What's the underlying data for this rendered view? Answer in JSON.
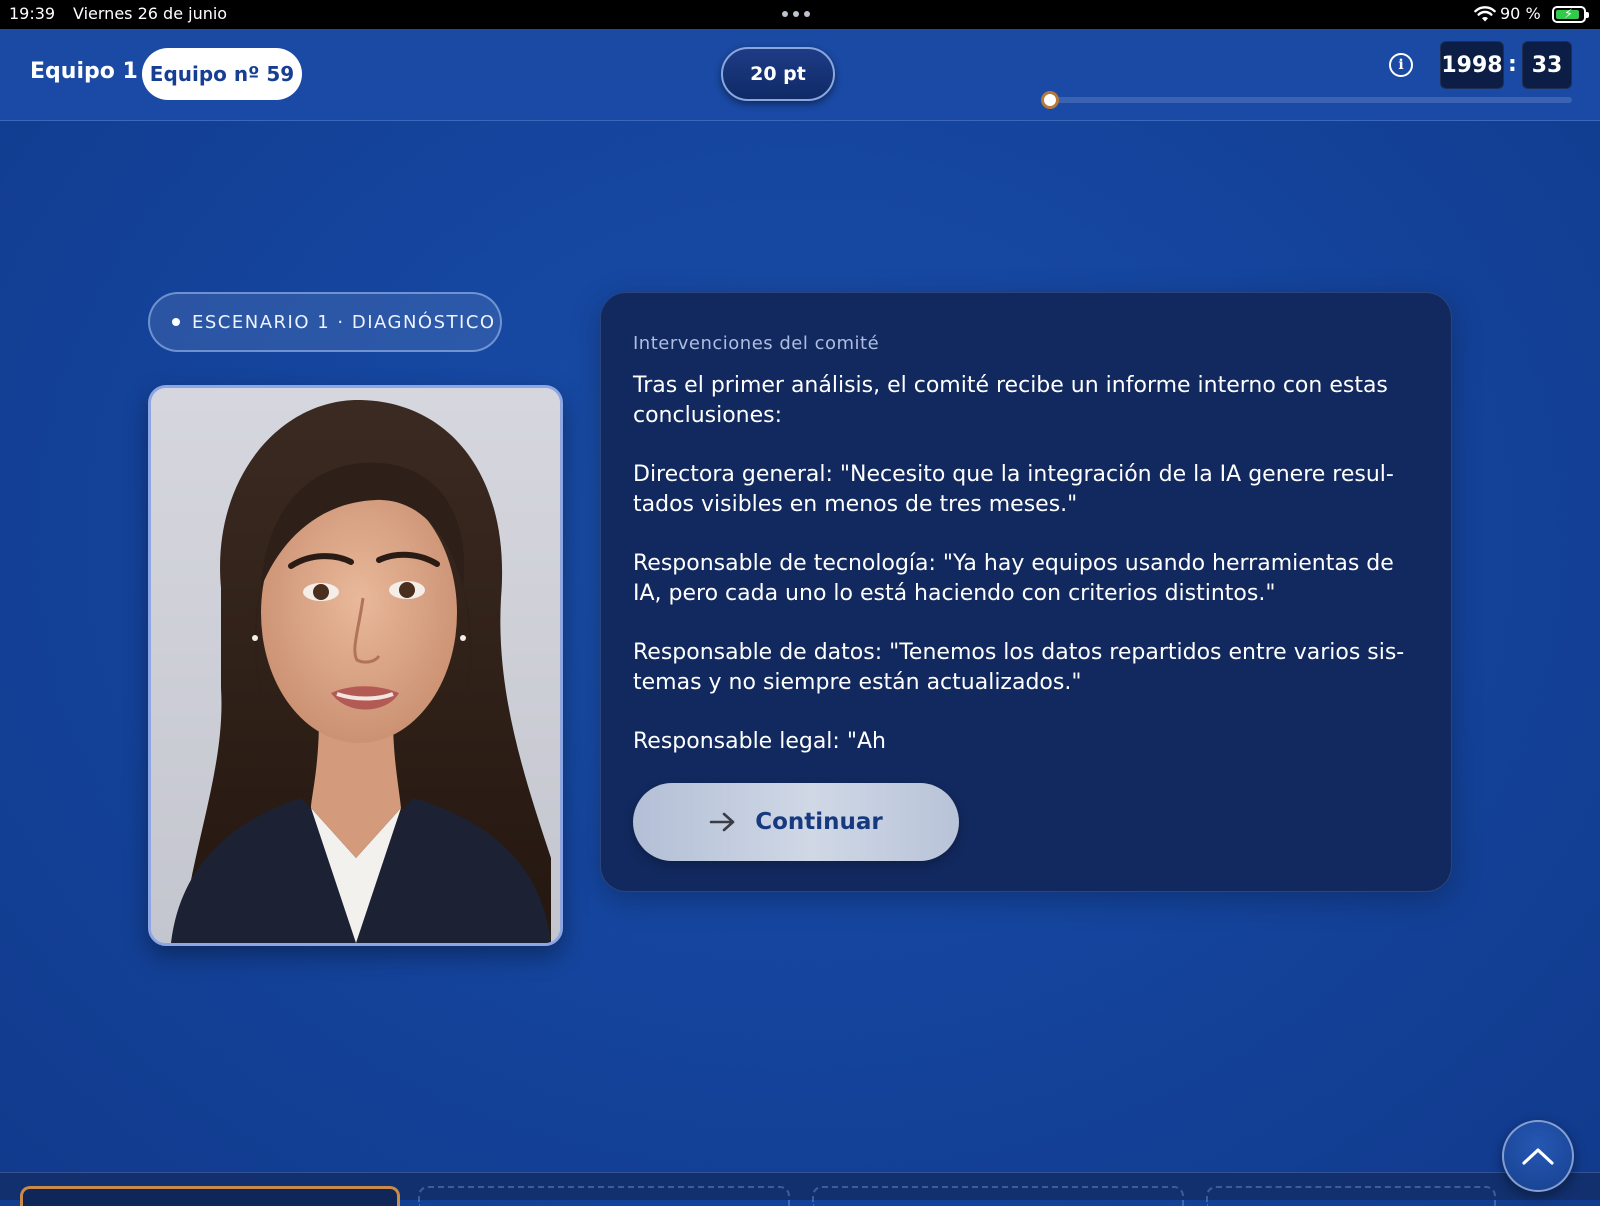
{
  "status_bar": {
    "time": "19:39",
    "date": "Viernes 26 de junio",
    "battery_percent": "90 %",
    "battery_level": 0.9,
    "icons": [
      "more-dots-icon",
      "wifi-icon",
      "battery-charging-icon"
    ]
  },
  "header": {
    "team_label": "Equipo 1",
    "team_pill": "Equipo nº 59",
    "points": "20 pt",
    "timer": {
      "minutes": "1998",
      "separator": ":",
      "seconds": "33"
    },
    "progress": 0.0,
    "icons": [
      "info-icon"
    ]
  },
  "scenario": {
    "chip_label": "ESCENARIO 1 · DIAGNÓSTICO"
  },
  "panel": {
    "kicker": "Intervenciones del comité",
    "paragraphs": [
      "Tras el primer análisis, el comité recibe un informe interno con estas conclusiones:",
      "Directora general: \"Necesito que la integración de la IA genere resul-tados visibles en menos de tres meses.\"",
      "Responsable de tecnología: \"Ya hay equipos usando herramientas de IA, pero cada uno lo está haciendo con criterios distintos.\"",
      "Responsable de datos: \"Tenemos los datos repartidos entre varios sis-temas y no siempre están actualizados.\"",
      "Responsable legal: \"Ah"
    ],
    "continue_label": "Continuar",
    "icons": [
      "arrow-right-icon"
    ]
  },
  "bottom": {
    "icons": [
      "chevron-up-icon"
    ]
  },
  "colors": {
    "background": "#1546a0",
    "panel": "#12295f",
    "accent_white": "#ffffff",
    "brand_blue": "#163f94",
    "button_grey": "#c4cee0",
    "active_tab_border": "#c98a4a"
  }
}
